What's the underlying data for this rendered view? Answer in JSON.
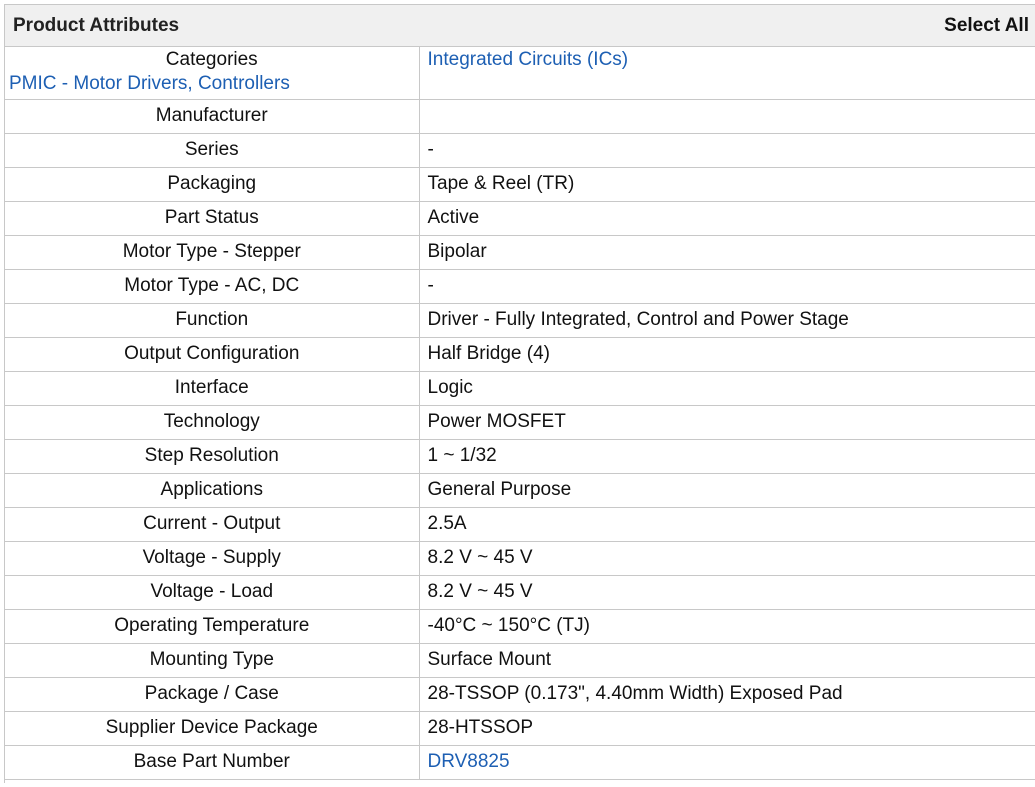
{
  "header": {
    "title": "Product Attributes",
    "select_all": "Select All"
  },
  "categories": {
    "label": "Categories",
    "value": "Integrated Circuits (ICs)",
    "sub": "PMIC - Motor Drivers, Controllers"
  },
  "rows": [
    {
      "label": "Manufacturer",
      "value": ""
    },
    {
      "label": "Series",
      "value": "-"
    },
    {
      "label": "Packaging",
      "value": "Tape & Reel (TR)"
    },
    {
      "label": "Part Status",
      "value": "Active"
    },
    {
      "label": "Motor Type - Stepper",
      "value": "Bipolar"
    },
    {
      "label": "Motor Type - AC, DC",
      "value": "-"
    },
    {
      "label": "Function",
      "value": "Driver - Fully Integrated, Control and Power Stage"
    },
    {
      "label": "Output Configuration",
      "value": "Half Bridge (4)"
    },
    {
      "label": "Interface",
      "value": "Logic"
    },
    {
      "label": "Technology",
      "value": "Power MOSFET"
    },
    {
      "label": "Step Resolution",
      "value": "1 ~ 1/32"
    },
    {
      "label": "Applications",
      "value": "General Purpose"
    },
    {
      "label": "Current - Output",
      "value": "2.5A"
    },
    {
      "label": "Voltage - Supply",
      "value": "8.2 V ~ 45 V"
    },
    {
      "label": "Voltage - Load",
      "value": "8.2 V ~ 45 V"
    },
    {
      "label": "Operating Temperature",
      "value": "-40°C ~ 150°C (TJ)"
    },
    {
      "label": "Mounting Type",
      "value": "Surface Mount"
    },
    {
      "label": "Package / Case",
      "value": "28-TSSOP (0.173\", 4.40mm Width) Exposed Pad"
    },
    {
      "label": "Supplier Device Package",
      "value": "28-HTSSOP"
    },
    {
      "label": "Base Part Number",
      "value": "DRV8825"
    }
  ],
  "colors": {
    "link": "#1d5fb3",
    "header_bg": "#f0f0f0",
    "border": "#c8c8c8"
  }
}
